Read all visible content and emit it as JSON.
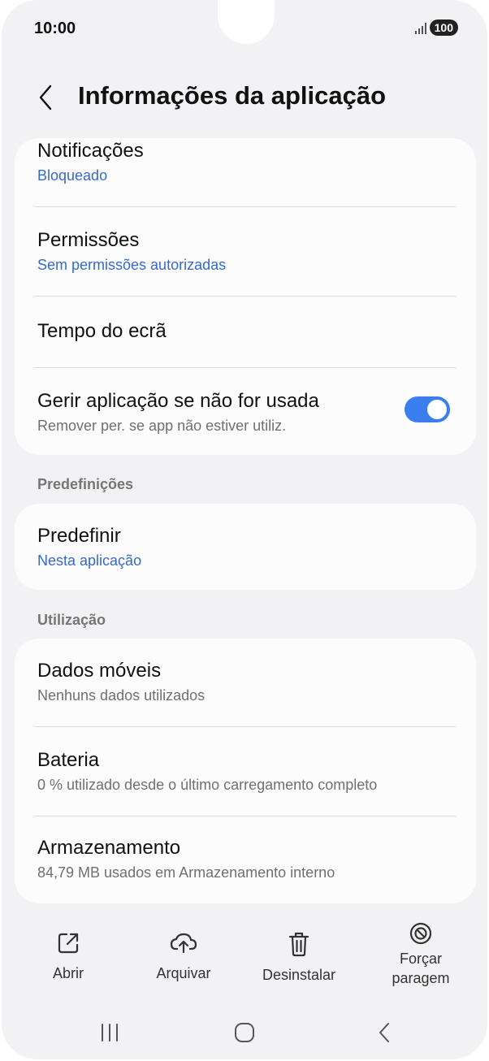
{
  "status_bar": {
    "time": "10:00",
    "battery": "100"
  },
  "header": {
    "title": "Informações da aplicação"
  },
  "group1": {
    "notifications": {
      "title": "Notificações",
      "subtitle": "Bloqueado"
    },
    "permissions": {
      "title": "Permissões",
      "subtitle": "Sem permissões autorizadas"
    },
    "screen_time": {
      "title": "Tempo do ecrã"
    },
    "manage_unused": {
      "title": "Gerir aplicação se não for usada",
      "subtitle": "Remover per. se app não estiver utiliz.",
      "toggle_on": true
    }
  },
  "defaults_section": {
    "label": "Predefinições",
    "item": {
      "title": "Predefinir",
      "subtitle": "Nesta aplicação"
    }
  },
  "usage_section": {
    "label": "Utilização",
    "mobile_data": {
      "title": "Dados móveis",
      "subtitle": "Nenhuns dados utilizados"
    },
    "battery": {
      "title": "Bateria",
      "subtitle": "0 % utilizado desde o último carregamento completo"
    },
    "storage": {
      "title": "Armazenamento",
      "subtitle": "84,79 MB usados em Armazenamento interno"
    }
  },
  "actions": {
    "open": "Abrir",
    "archive": "Arquivar",
    "uninstall": "Desinstalar",
    "force_stop_line1": "Forçar",
    "force_stop_line2": "paragem"
  },
  "colors": {
    "accent": "#3b7ef0",
    "link": "#3769c7",
    "background": "#f2f2f4",
    "card": "#fcfcfc"
  }
}
